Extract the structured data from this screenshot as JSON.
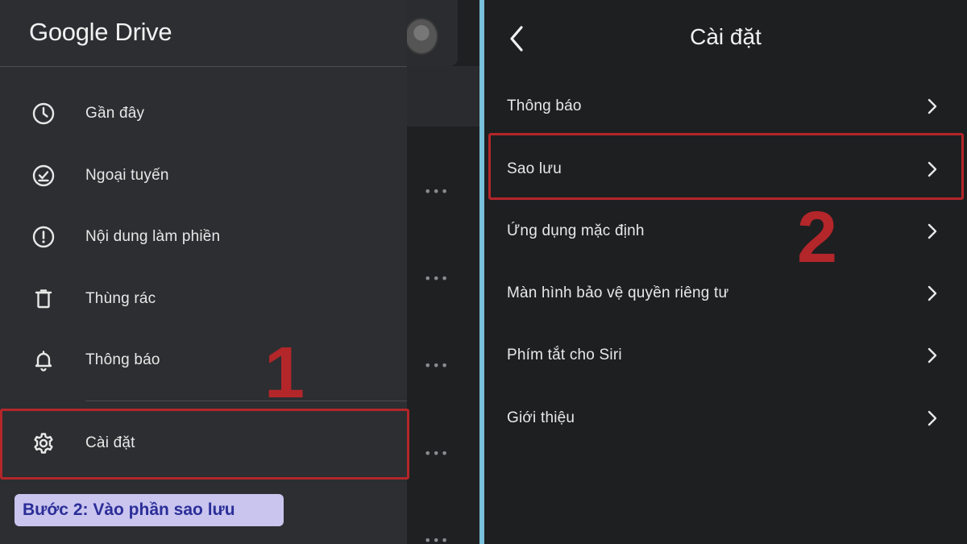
{
  "drawer": {
    "brand": "Google Drive",
    "items": [
      {
        "label": "Gần đây",
        "icon": "clock-icon"
      },
      {
        "label": "Ngoại tuyến",
        "icon": "offline-check-icon"
      },
      {
        "label": "Nội dung làm phiền",
        "icon": "alert-circle-icon"
      },
      {
        "label": "Thùng rác",
        "icon": "trash-icon"
      },
      {
        "label": "Thông báo",
        "icon": "bell-icon"
      },
      {
        "label": "Cài đặt",
        "icon": "gear-icon"
      }
    ]
  },
  "annotations": {
    "step1": "1",
    "step2": "2",
    "caption": "Bước 2: Vào phần sao lưu",
    "highlight_color": "#b3262a"
  },
  "settings": {
    "title": "Cài đặt",
    "rows": [
      {
        "label": "Thông báo"
      },
      {
        "label": "Sao lưu"
      },
      {
        "label": "Ứng dụng mặc định"
      },
      {
        "label": "Màn hình bảo vệ quyền riêng tư"
      },
      {
        "label": "Phím tắt cho Siri"
      },
      {
        "label": "Giới thiệu"
      }
    ]
  },
  "colors": {
    "caption_bg": "#c9c5ef",
    "caption_text": "#2b2e98",
    "split_line": "#79c0db"
  }
}
